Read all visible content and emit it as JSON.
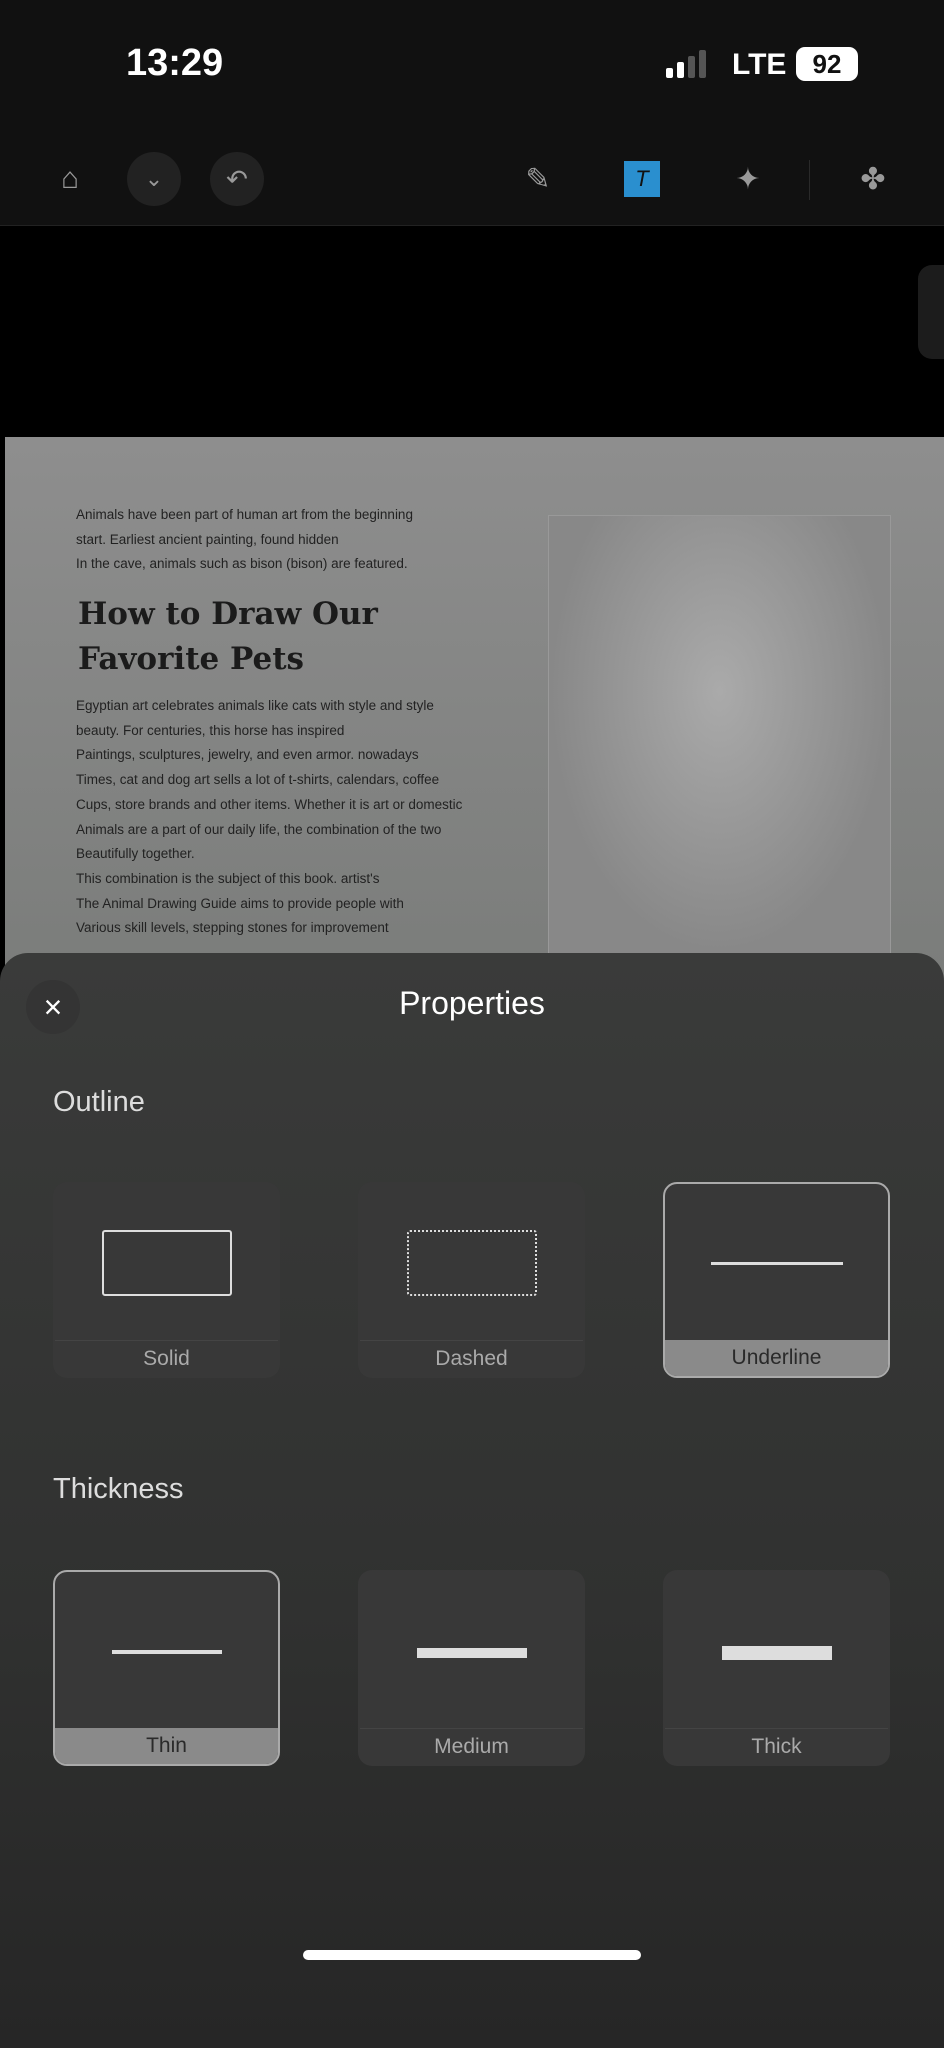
{
  "status": {
    "time": "13:29",
    "network": "LTE",
    "battery": "92"
  },
  "toolbar": {
    "icons": [
      "home-icon",
      "chevron-down-icon",
      "undo-icon",
      "highlighter-icon",
      "image-text-icon",
      "ai-image-icon",
      "apps-grid-icon"
    ],
    "accent": "#2a8fcf"
  },
  "document": {
    "intro": [
      "Animals have been part of human art from the beginning",
      "start. Earliest ancient painting, found hidden",
      "In the cave, animals such as bison (bison) are featured."
    ],
    "heading": [
      "How to Draw Our",
      "Favorite Pets"
    ],
    "body": [
      "Egyptian art celebrates animals like cats with style and style",
      "beauty. For centuries, this horse has inspired",
      "Paintings, sculptures, jewelry, and even armor. nowadays",
      "Times, cat and dog art sells a lot of t-shirts, calendars, coffee",
      "Cups, store brands and other items. Whether it is art or domestic",
      "Animals are a part of our daily life, the combination of the two",
      "Beautifully together.",
      "This combination is the subject of this book. artist's",
      "The Animal Drawing Guide aims to provide people with",
      "Various skill levels, stepping stones for improvement"
    ]
  },
  "sheet": {
    "title": "Properties",
    "outline": {
      "label": "Outline",
      "options": [
        "Solid",
        "Dashed",
        "Underline"
      ],
      "selected": "Underline"
    },
    "thickness": {
      "label": "Thickness",
      "options": [
        "Thin",
        "Medium",
        "Thick"
      ],
      "selected": "Thin"
    }
  }
}
